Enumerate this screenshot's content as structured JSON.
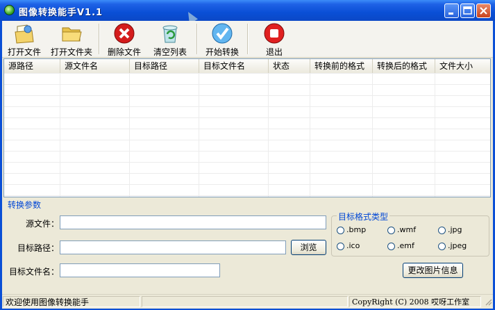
{
  "window": {
    "title": "图像转换能手V1.1"
  },
  "toolbar": {
    "open_file": "打开文件",
    "open_folder": "打开文件夹",
    "delete_file": "删除文件",
    "clear_list": "清空列表",
    "start_convert": "开始转换",
    "exit": "退出"
  },
  "list": {
    "columns": [
      "源路径",
      "源文件名",
      "目标路径",
      "目标文件名",
      "状态",
      "转换前的格式",
      "转换后的格式",
      "文件大小"
    ]
  },
  "params": {
    "group_title": "转换参数",
    "source_file_label": "源文件：",
    "source_file_value": "",
    "target_path_label": "目标路径：",
    "target_path_value": "",
    "browse": "浏览",
    "target_name_label": "目标文件名：",
    "target_name_value": "",
    "format_group_title": "目标格式类型",
    "formats": [
      ".bmp",
      ".wmf",
      ".jpg",
      ".ico",
      ".emf",
      ".jpeg"
    ],
    "change_info": "更改图片信息"
  },
  "status": {
    "welcome": "欢迎使用图像转换能手",
    "copyright": "CopyRight (C) 2008 哎呀工作室"
  },
  "colors": {
    "title_bar": "#0a4fd6",
    "group_title": "#0046d5",
    "window_bg": "#ece9d8"
  }
}
